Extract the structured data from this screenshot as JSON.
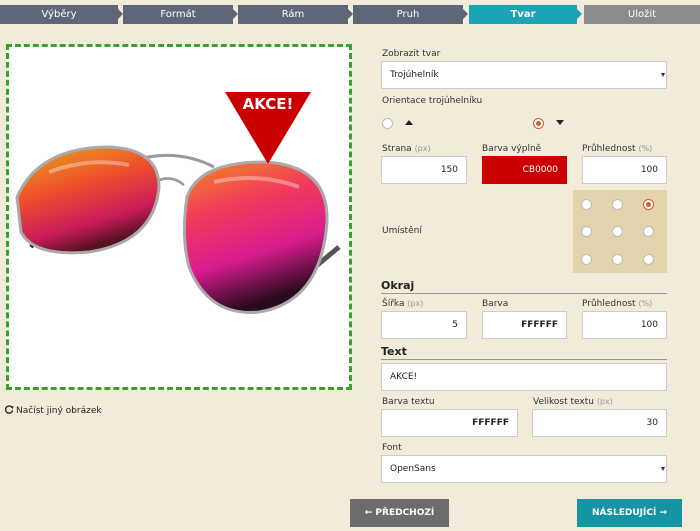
{
  "steps": [
    {
      "label": "Výběry"
    },
    {
      "label": "Formát"
    },
    {
      "label": "Rám"
    },
    {
      "label": "Pruh"
    },
    {
      "label": "Tvar"
    },
    {
      "label": "Uložit"
    }
  ],
  "preview": {
    "badge_text": "AKCE!",
    "badge_color": "#CB0000",
    "reload_label": "Načíst jiný obrázek"
  },
  "shape": {
    "label": "Zobrazit tvar",
    "value": "Trojúhelník",
    "orientation_label": "Orientace trojúhelníku",
    "orientation_selected": "down"
  },
  "dims": {
    "side_label": "Strana",
    "side_unit": "(px)",
    "side_value": "150",
    "fill_label": "Barva výplně",
    "fill_value": "CB0000",
    "opacity_label": "Průhlednost",
    "opacity_unit": "(%)",
    "opacity_value": "100"
  },
  "placement": {
    "label": "Umístění",
    "selected": "top-right"
  },
  "border": {
    "title": "Okraj",
    "width_label": "Šířka",
    "width_unit": "(px)",
    "width_value": "5",
    "color_label": "Barva",
    "color_value": "FFFFFF",
    "opacity_label": "Průhlednost",
    "opacity_unit": "(%)",
    "opacity_value": "100"
  },
  "text": {
    "title": "Text",
    "value": "AKCE!",
    "color_label": "Barva textu",
    "color_value": "FFFFFF",
    "size_label": "Velikost textu",
    "size_unit": "(px)",
    "size_value": "30",
    "font_label": "Font",
    "font_value": "OpenSans"
  },
  "nav": {
    "prev_label": "← PŘEDCHOZÍ",
    "next_label": "NÁSLEDUJÍCÍ →"
  }
}
